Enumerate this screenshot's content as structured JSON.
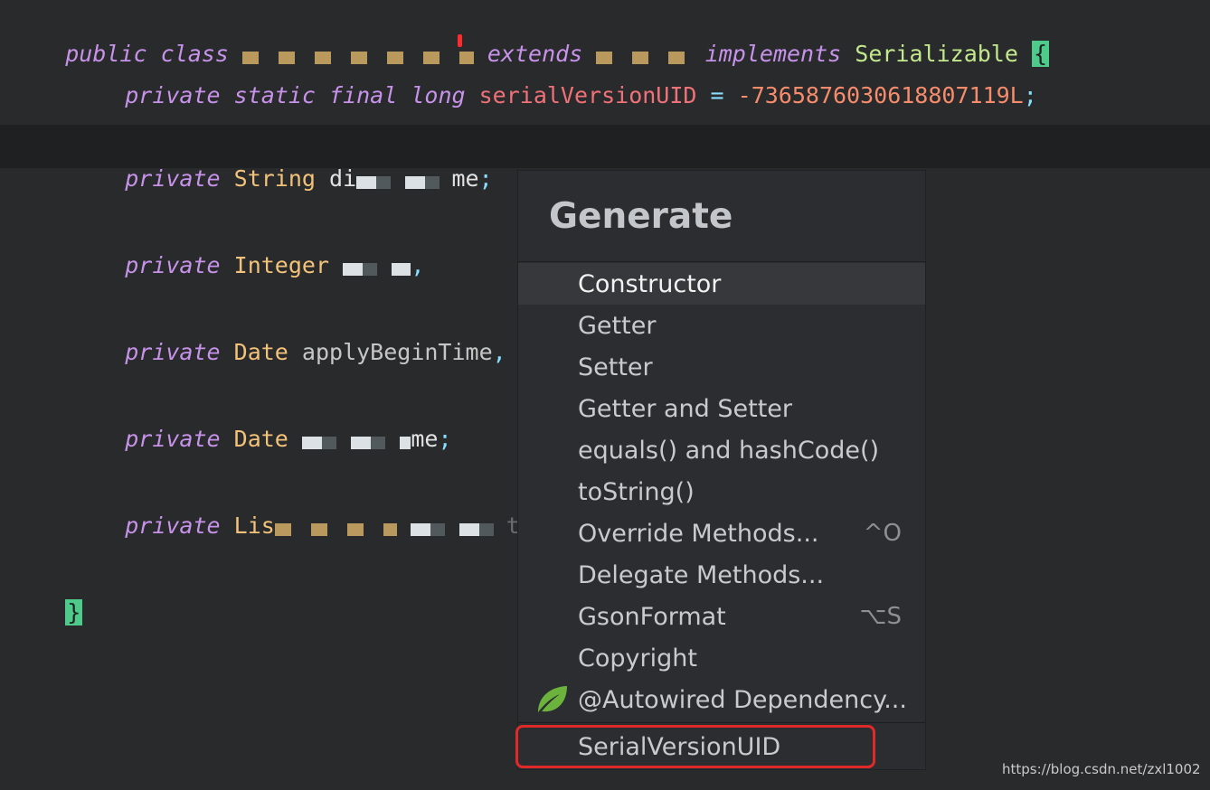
{
  "editor": {
    "line1": {
      "kw_public": "public",
      "kw_class": "class",
      "class_name_blurred": "▇▇▇▇▇▇▇▇▇▇▇▇▇▇▇▇▇",
      "kw_extends": "extends",
      "parent_blurred": "▇ ▇▇▇▇▇",
      "kw_implements": "implements",
      "iface": "Serializable",
      "brace": "{"
    },
    "line2": {
      "kw_private": "private",
      "kw_static": "static",
      "kw_final": "final",
      "kw_long": "long",
      "field": "serialVersionUID",
      "eq": "=",
      "value": "-7365876030618807119L",
      "semi": ";"
    },
    "line3": {
      "kw_private": "private",
      "type": "String",
      "name_start": "di",
      "name_blurred": "▇▇▇▇▇▇▇",
      "name_end": "me",
      "semi": ";"
    },
    "line4": {
      "kw_private": "private",
      "type": "Integer",
      "name_blurred": "▇▇▇▇▇",
      "semi": ","
    },
    "line5": {
      "kw_private": "private",
      "type": "Date",
      "name": "applyBeginTime",
      "semi": ","
    },
    "line6": {
      "kw_private": "private",
      "type": "Date",
      "name_blurred": "▇▇▇▇▇▇▇▇",
      "name_end": "me",
      "semi": ";"
    },
    "line7": {
      "kw_private": "private",
      "type": "Lis",
      "generic_blurred": "▇▇▇▇▇▇▇▇▇",
      "name_blurred": "▇▇▇▇▇▇▇",
      "name_end": "torNo"
    },
    "closing_brace": "}"
  },
  "popup": {
    "title": "Generate",
    "items": [
      {
        "label": "Constructor",
        "shortcut": "",
        "selected": true
      },
      {
        "label": "Getter",
        "shortcut": ""
      },
      {
        "label": "Setter",
        "shortcut": ""
      },
      {
        "label": "Getter and Setter",
        "shortcut": ""
      },
      {
        "label": "equals() and hashCode()",
        "shortcut": ""
      },
      {
        "label": "toString()",
        "shortcut": ""
      },
      {
        "label": "Override Methods...",
        "shortcut": "^O"
      },
      {
        "label": "Delegate Methods...",
        "shortcut": ""
      },
      {
        "label": "GsonFormat",
        "shortcut": "⌥S"
      },
      {
        "label": "Copyright",
        "shortcut": ""
      },
      {
        "label": "@Autowired Dependency...",
        "shortcut": "",
        "icon": "spring-leaf-icon"
      }
    ],
    "last_item": {
      "label": "SerialVersionUID"
    }
  },
  "watermark": "https://blog.csdn.net/zxl1002",
  "colors": {
    "highlight": "#e02a2a",
    "leaf": "#6cb33e"
  }
}
